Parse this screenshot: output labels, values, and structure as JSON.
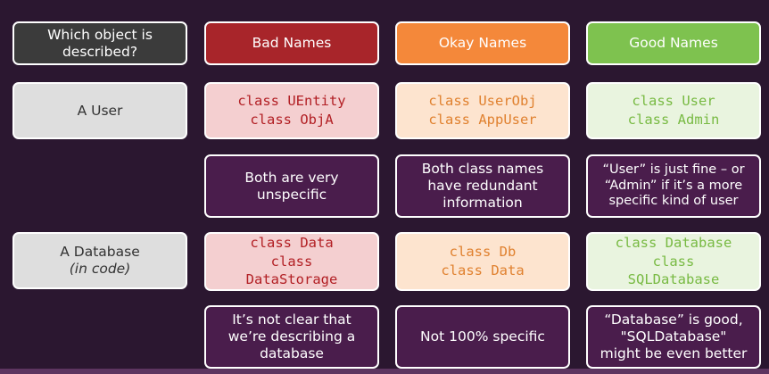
{
  "header": {
    "question_line1": "Which object is",
    "question_line2": "described?",
    "bad": "Bad Names",
    "okay": "Okay Names",
    "good": "Good Names"
  },
  "user": {
    "label": "A User",
    "bad": [
      "class UEntity",
      "class ObjA"
    ],
    "okay": [
      "class UserObj",
      "class AppUser"
    ],
    "good": [
      "class User",
      "class Admin"
    ],
    "bad_comment": [
      "Both are very",
      "unspecific"
    ],
    "okay_comment": [
      "Both class names",
      "have redundant",
      "information"
    ],
    "good_comment": [
      "“User” is just fine – or",
      "“Admin” if it’s a more",
      "specific kind of user"
    ]
  },
  "database": {
    "label": "A Database",
    "label_note": "(in code)",
    "bad": [
      "class Data",
      "class",
      "DataStorage"
    ],
    "okay": [
      "class Db",
      "class Data"
    ],
    "good": [
      "class Database",
      "class",
      "SQLDatabase"
    ],
    "bad_comment": [
      "It’s not clear that",
      "we’re describing a",
      "database"
    ],
    "okay_comment": [
      "Not 100% specific"
    ],
    "good_comment": [
      "“Database” is good,",
      "\"SQLDatabase\"",
      "might be even better"
    ]
  },
  "colors": {
    "background": "#2b1730",
    "bad": "#a8252a",
    "okay": "#f4883a",
    "good": "#7ec24f"
  }
}
